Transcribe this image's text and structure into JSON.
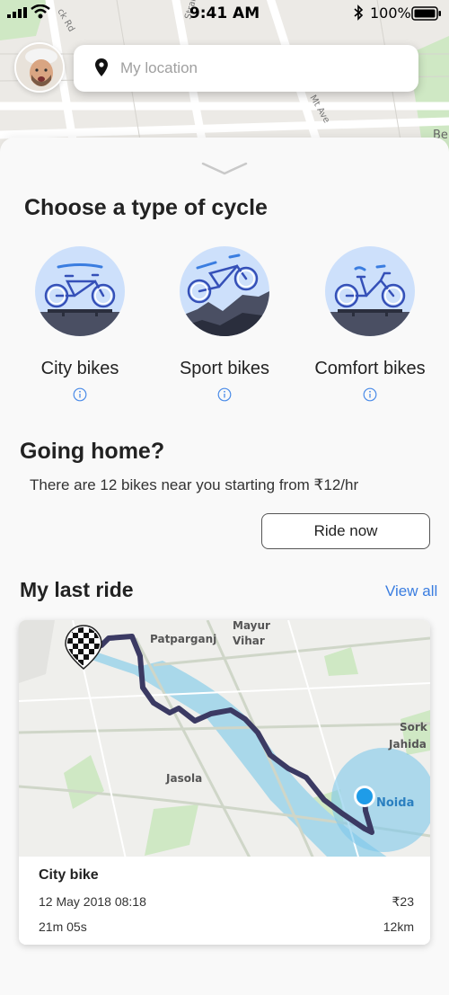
{
  "status_bar": {
    "time": "9:41 AM",
    "battery": "100%"
  },
  "map_labels": {
    "road_1": "ck Rd",
    "road_2": "Stran",
    "road_3": "Mt Ave",
    "edge": "Be"
  },
  "search": {
    "placeholder": "My location"
  },
  "cycle_section": {
    "title": "Choose a type of cycle",
    "types": [
      {
        "label": "City bikes",
        "icon": "city-bike-icon"
      },
      {
        "label": "Sport bikes",
        "icon": "sport-bike-icon"
      },
      {
        "label": "Comfort bikes",
        "icon": "comfort-bike-icon"
      }
    ]
  },
  "home_section": {
    "title": "Going home?",
    "text": "There are 12 bikes near you starting from ₹12/hr",
    "ride_now_label": "Ride now"
  },
  "last_ride": {
    "title": "My last ride",
    "view_all": "View all",
    "map_labels": {
      "mayur_vihar": "Mayur\nVihar",
      "patparganj": "Patparganj",
      "jasola": "Jasola",
      "sork": "Sork",
      "jahida": "Jahida",
      "noida": "Noida"
    },
    "bike": "City bike",
    "date": "12 May 2018 08:18",
    "price": "₹23",
    "duration": "21m 05s",
    "distance": "12km"
  },
  "colors": {
    "accent": "#3a7de0",
    "route": "#3b3a63",
    "water": "#a9d8ea",
    "park": "#cfe8c4",
    "bike_circle": "#cde0fb",
    "info_icon": "#4a8be8"
  }
}
